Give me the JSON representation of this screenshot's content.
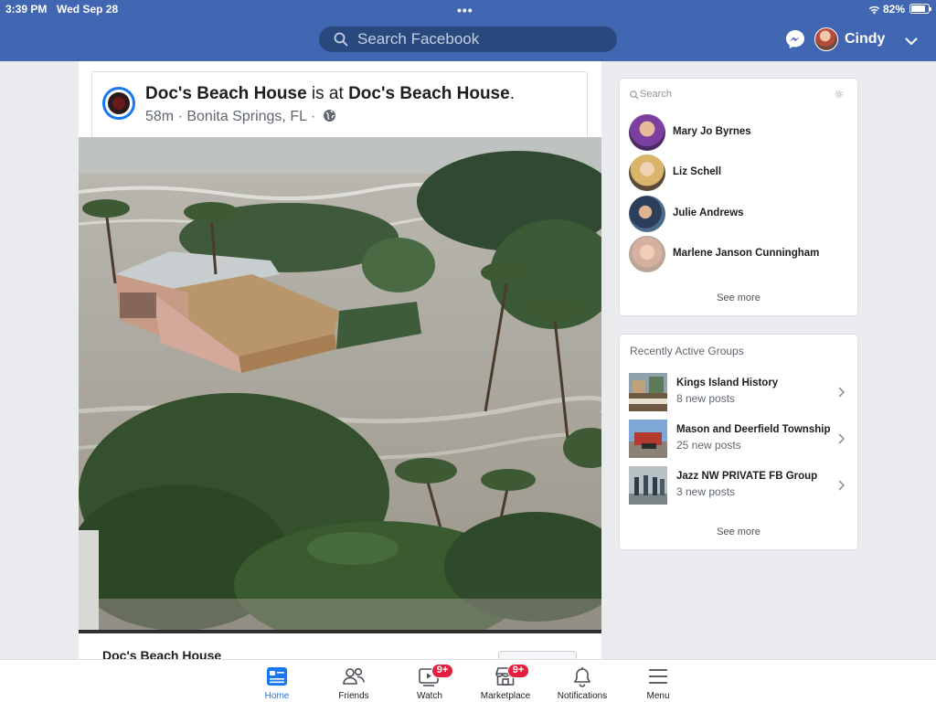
{
  "status_bar": {
    "time": "3:39 PM",
    "date": "Wed Sep 28",
    "battery": "82%"
  },
  "header": {
    "search_placeholder": "Search Facebook",
    "user_name": "Cindy",
    "brand_color": "#4267b2"
  },
  "post": {
    "page_name": "Doc's Beach House",
    "connector": "is at",
    "location_name": "Doc's Beach House",
    "period": ".",
    "time_ago": "58m",
    "location": "Bonita Springs, FL",
    "separator": "·",
    "footer_name": "Doc's Beach House"
  },
  "contacts": {
    "search_placeholder": "Search",
    "items": [
      {
        "name": "Mary Jo Byrnes"
      },
      {
        "name": "Liz Schell"
      },
      {
        "name": "Julie Andrews"
      },
      {
        "name": "Marlene Janson Cunningham"
      }
    ],
    "see_more": "See more"
  },
  "groups": {
    "title": "Recently Active Groups",
    "items": [
      {
        "name": "Kings Island History",
        "posts": "8 new posts"
      },
      {
        "name": "Mason and Deerfield Township",
        "posts": "25 new posts"
      },
      {
        "name": "Jazz NW PRIVATE FB Group",
        "posts": "3 new posts"
      }
    ],
    "see_more": "See more"
  },
  "tabs": [
    {
      "label": "Home",
      "icon": "home-icon",
      "active": true
    },
    {
      "label": "Friends",
      "icon": "friends-icon"
    },
    {
      "label": "Watch",
      "icon": "watch-icon",
      "badge": "9+"
    },
    {
      "label": "Marketplace",
      "icon": "marketplace-icon",
      "badge": "9+"
    },
    {
      "label": "Notifications",
      "icon": "bell-icon"
    },
    {
      "label": "Menu",
      "icon": "menu-icon"
    }
  ]
}
